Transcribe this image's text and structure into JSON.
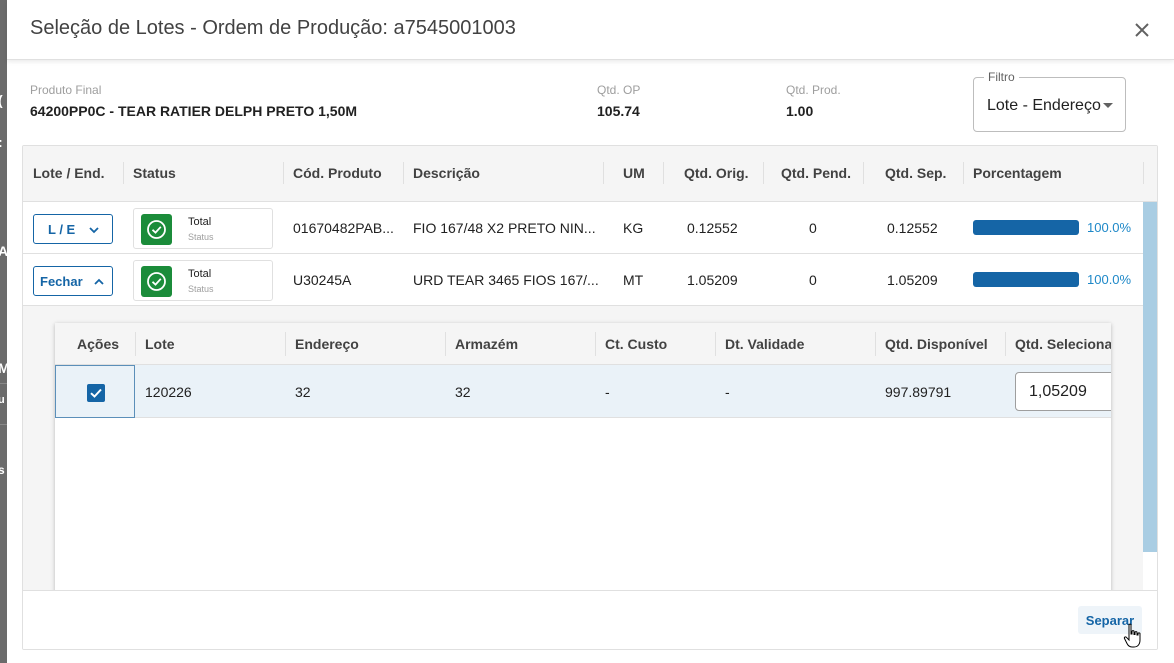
{
  "dialog": {
    "title": "Seleção de Lotes - Ordem de Produção: a7545001003",
    "close_icon": "close-icon"
  },
  "info": {
    "produto_final_label": "Produto Final",
    "produto_final_value": "64200PP0C - TEAR RATIER DELPH PRETO 1,50M",
    "qtd_op_label": "Qtd. OP",
    "qtd_op_value": "105.74",
    "qtd_prod_label": "Qtd. Prod.",
    "qtd_prod_value": "1.00"
  },
  "filter": {
    "legend": "Filtro",
    "value": "Lote - Endereço"
  },
  "main_table": {
    "headers": [
      "Lote / End.",
      "Status",
      "Cód. Produto",
      "Descrição",
      "UM",
      "Qtd. Orig.",
      "Qtd. Pend.",
      "Qtd. Sep.",
      "Porcentagem"
    ],
    "rows": [
      {
        "button": "L / E",
        "button_icon": "chevron-down-icon",
        "status": "Total",
        "status_sub": "Status",
        "codigo": "01670482PAB...",
        "descricao": "FIO 167/48 X2 PRETO NIN...",
        "um": "KG",
        "qtd_orig": "0.12552",
        "qtd_pend": "0",
        "qtd_sep": "0.12552",
        "progress": 1.0,
        "pct": "100.0%"
      },
      {
        "button": "Fechar",
        "button_icon": "chevron-up-icon",
        "status": "Total",
        "status_sub": "Status",
        "codigo": "U30245A",
        "descricao": "URD TEAR 3465 FIOS 167/...",
        "um": "MT",
        "qtd_orig": "1.05209",
        "qtd_pend": "0",
        "qtd_sep": "1.05209",
        "progress": 1.0,
        "pct": "100.0%"
      }
    ]
  },
  "sub_table": {
    "headers": [
      "Ações",
      "Lote",
      "Endereço",
      "Armazém",
      "Ct. Custo",
      "Dt. Validade",
      "Qtd. Disponível",
      "Qtd. Selecionada"
    ],
    "row": {
      "checked": true,
      "lote": "120226",
      "endereco": "32",
      "armazem": "32",
      "ct_custo": "-",
      "dt_validade": "-",
      "qtd_disponivel": "997.89791",
      "qtd_selecionada": "1,05209"
    }
  },
  "footer": {
    "separar_label": "Separar"
  },
  "colors": {
    "primary": "#1565a6",
    "success": "#1b8c3a",
    "pct_text": "#1e88c8"
  }
}
